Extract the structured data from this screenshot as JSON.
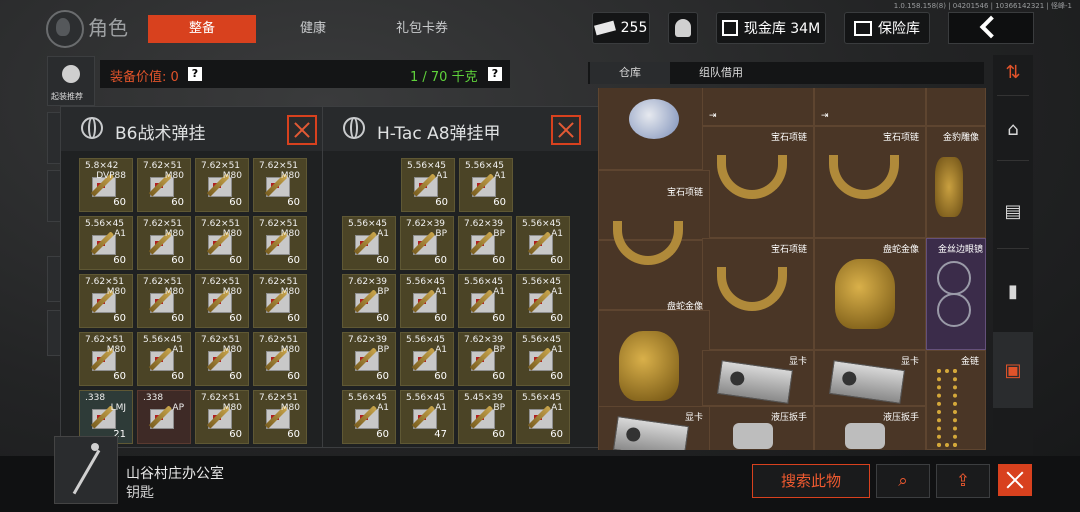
{
  "version": "1.0.158.158(8) | 04201546 | 10366142321 | 怪峰-1",
  "header": {
    "title": "角色",
    "tabs": [
      "整备",
      "健康",
      "礼包卡券"
    ],
    "ticket_count": "255",
    "cash": "现金库 34M",
    "vault": "保险库"
  },
  "left": {
    "recommend_label": "起装推荐"
  },
  "value_bar": {
    "value": "装备价值: 0",
    "weight": "1 / 70 千克"
  },
  "panel1": {
    "title": "B6战术弹挂",
    "cells": [
      {
        "cal": "5.8×42",
        "typ": "DVP88",
        "cnt": "60"
      },
      {
        "cal": "7.62×51",
        "typ": "M80",
        "cnt": "60"
      },
      {
        "cal": "7.62×51",
        "typ": "M80",
        "cnt": "60"
      },
      {
        "cal": "7.62×51",
        "typ": "M80",
        "cnt": "60"
      },
      {
        "cal": "5.56×45",
        "typ": "A1",
        "cnt": "60"
      },
      {
        "cal": "7.62×51",
        "typ": "M80",
        "cnt": "60"
      },
      {
        "cal": "7.62×51",
        "typ": "M80",
        "cnt": "60"
      },
      {
        "cal": "7.62×51",
        "typ": "M80",
        "cnt": "60"
      },
      {
        "cal": "7.62×51",
        "typ": "M80",
        "cnt": "60"
      },
      {
        "cal": "7.62×51",
        "typ": "M80",
        "cnt": "60"
      },
      {
        "cal": "7.62×51",
        "typ": "M80",
        "cnt": "60"
      },
      {
        "cal": "7.62×51",
        "typ": "M80",
        "cnt": "60"
      },
      {
        "cal": "7.62×51",
        "typ": "M80",
        "cnt": "60"
      },
      {
        "cal": "5.56×45",
        "typ": "A1",
        "cnt": "60"
      },
      {
        "cal": "7.62×51",
        "typ": "M80",
        "cnt": "60"
      },
      {
        "cal": "7.62×51",
        "typ": "M80",
        "cnt": "60"
      },
      {
        "cal": ".338",
        "typ": "LMJ",
        "cnt": "21"
      },
      {
        "cal": ".338",
        "typ": "AP",
        "cnt": ""
      },
      {
        "cal": "7.62×51",
        "typ": "M80",
        "cnt": "60"
      },
      {
        "cal": "7.62×51",
        "typ": "M80",
        "cnt": "60"
      }
    ]
  },
  "panel2": {
    "title": "H-Tac A8弹挂甲",
    "top_cells": [
      {
        "cal": "5.56×45",
        "typ": "A1",
        "cnt": "60"
      },
      {
        "cal": "5.56×45",
        "typ": "A1",
        "cnt": "60"
      }
    ],
    "cells": [
      {
        "cal": "5.56×45",
        "typ": "A1",
        "cnt": "60"
      },
      {
        "cal": "7.62×39",
        "typ": "BP",
        "cnt": "60"
      },
      {
        "cal": "7.62×39",
        "typ": "BP",
        "cnt": "60"
      },
      {
        "cal": "5.56×45",
        "typ": "A1",
        "cnt": "60"
      },
      {
        "cal": "7.62×39",
        "typ": "BP",
        "cnt": "60"
      },
      {
        "cal": "5.56×45",
        "typ": "A1",
        "cnt": "60"
      },
      {
        "cal": "5.56×45",
        "typ": "A1",
        "cnt": "60"
      },
      {
        "cal": "5.56×45",
        "typ": "A1",
        "cnt": "60"
      },
      {
        "cal": "7.62×39",
        "typ": "BP",
        "cnt": "60"
      },
      {
        "cal": "5.56×45",
        "typ": "A1",
        "cnt": "60"
      },
      {
        "cal": "7.62×39",
        "typ": "BP",
        "cnt": "60"
      },
      {
        "cal": "5.56×45",
        "typ": "A1",
        "cnt": "60"
      },
      {
        "cal": "5.56×45",
        "typ": "A1",
        "cnt": "60"
      },
      {
        "cal": "5.56×45",
        "typ": "A1",
        "cnt": "47"
      },
      {
        "cal": "5.45×39",
        "typ": "BP",
        "cnt": "60"
      },
      {
        "cal": "5.56×45",
        "typ": "A1",
        "cnt": "60"
      }
    ]
  },
  "warehouse": {
    "tabs": [
      "仓库",
      "组队借用"
    ],
    "labels": {
      "necklace": "宝石项链",
      "leopard": "金豹雕像",
      "snake": "盘蛇金像",
      "glasses": "金丝边眼镜",
      "gpu": "显卡",
      "wrench": "液压扳手",
      "chain": "金链"
    }
  },
  "selected_item": {
    "name": "山谷村庄办公室",
    "type": "钥匙"
  },
  "bottom": {
    "search_label": "搜索此物"
  }
}
